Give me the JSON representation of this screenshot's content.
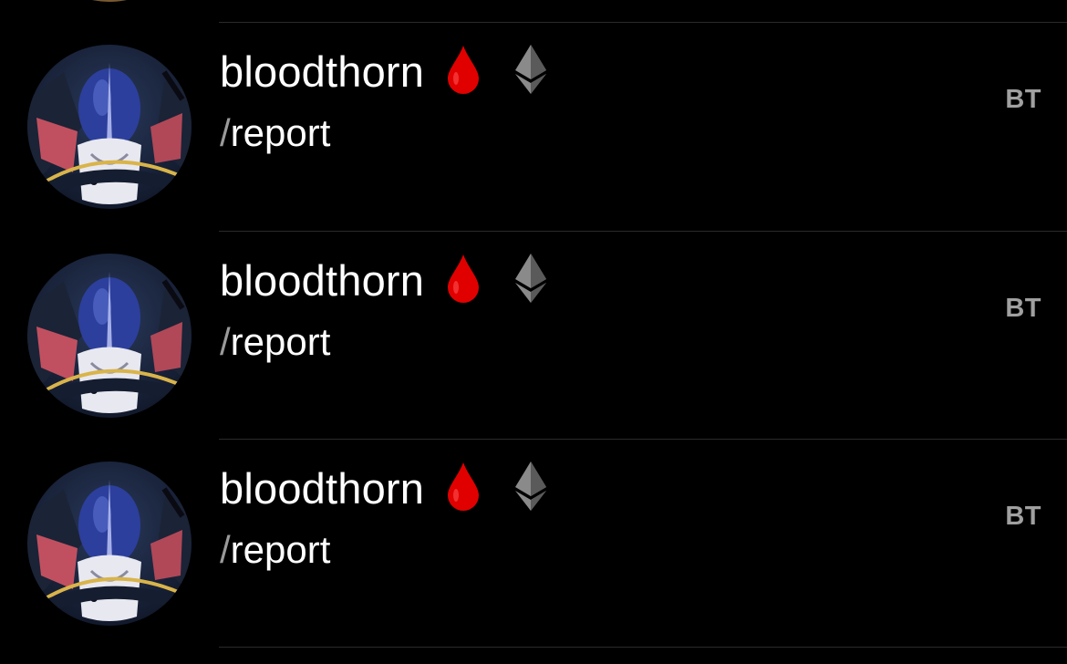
{
  "messages": [
    {
      "username": "bloodthorn",
      "emoji_1": "drop-of-blood-icon",
      "emoji_2": "ethereum-icon",
      "command_slash": "/",
      "command_text": "report",
      "tag": "BT"
    },
    {
      "username": "bloodthorn",
      "emoji_1": "drop-of-blood-icon",
      "emoji_2": "ethereum-icon",
      "command_slash": "/",
      "command_text": "report",
      "tag": "BT"
    },
    {
      "username": "bloodthorn",
      "emoji_1": "drop-of-blood-icon",
      "emoji_2": "ethereum-icon",
      "command_slash": "/",
      "command_text": "report",
      "tag": "BT"
    }
  ],
  "colors": {
    "background": "#000000",
    "divider": "#2a2a2a",
    "username": "#ffffff",
    "tag": "#a0a0a0",
    "blood": "#e00000"
  }
}
